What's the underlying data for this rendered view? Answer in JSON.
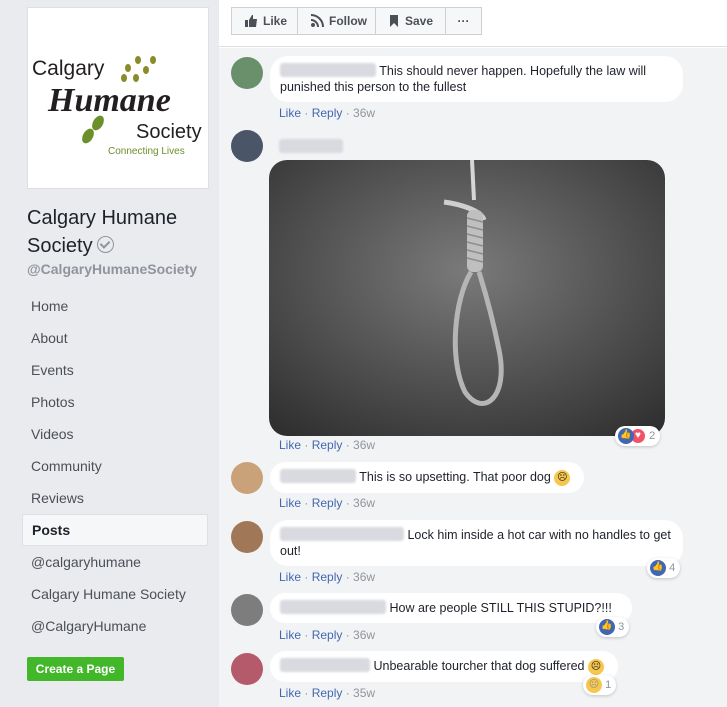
{
  "sidebar": {
    "logo": {
      "line1": "Calgary",
      "line2": "Humane",
      "line3": "Society",
      "tagline": "Connecting Lives"
    },
    "page_name": "Calgary Humane Society",
    "handle": "@CalgaryHumaneSociety",
    "nav": [
      {
        "label": "Home"
      },
      {
        "label": "About"
      },
      {
        "label": "Events"
      },
      {
        "label": "Photos"
      },
      {
        "label": "Videos"
      },
      {
        "label": "Community"
      },
      {
        "label": "Reviews"
      },
      {
        "label": "Posts",
        "active": true
      },
      {
        "label": "@calgaryhumane"
      },
      {
        "label": "Calgary Humane Society"
      },
      {
        "label": "@CalgaryHumane"
      }
    ],
    "create_page": "Create a Page"
  },
  "actionbar": {
    "like": "Like",
    "follow": "Follow",
    "save": "Save",
    "more": "···"
  },
  "comments": [
    {
      "text": "This should never happen. Hopefully the law will punished this person to the fullest",
      "like": "Like",
      "reply": "Reply",
      "time": "36w"
    },
    {
      "text": "",
      "like": "Like",
      "reply": "Reply",
      "time": "36w",
      "reactions": "2"
    },
    {
      "text": "This is so upsetting. That poor dog",
      "like": "Like",
      "reply": "Reply",
      "time": "36w"
    },
    {
      "text": "Lock him inside a hot car with no handles to get out!",
      "like": "Like",
      "reply": "Reply",
      "time": "36w",
      "reactions": "4"
    },
    {
      "text": "How are people STILL THIS STUPID?!!!",
      "like": "Like",
      "reply": "Reply",
      "time": "36w",
      "reactions": "3"
    },
    {
      "text": "Unbearable tourcher that dog suffered",
      "like": "Like",
      "reply": "Reply",
      "time": "35w",
      "reactions": "1"
    }
  ],
  "colors": {
    "accent": "#4267b2",
    "green": "#42b72a",
    "meta": "#90949c"
  }
}
